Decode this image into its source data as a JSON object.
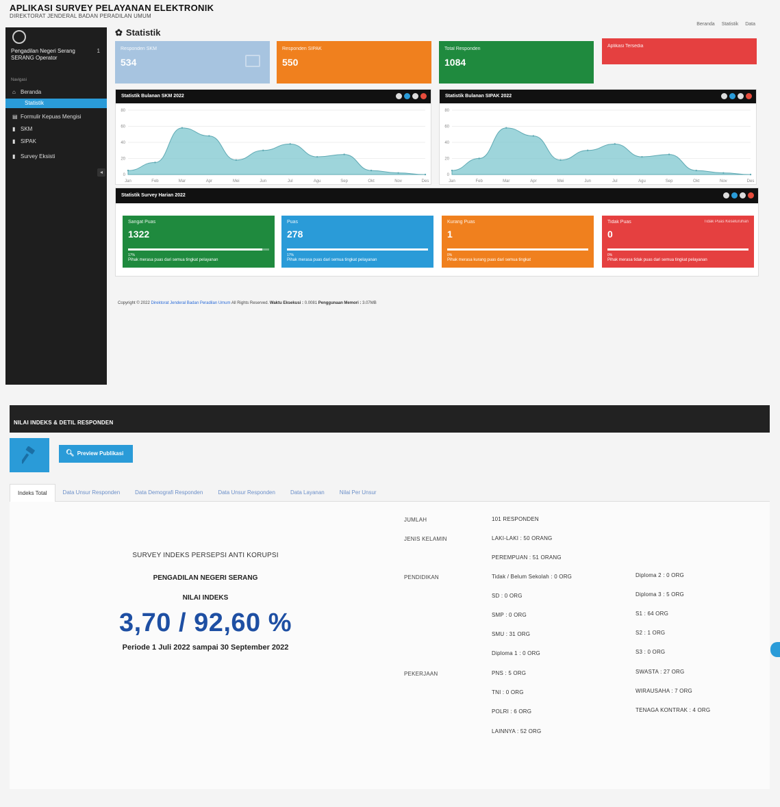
{
  "header": {
    "title": "APLIKASI SURVEY PELAYANAN ELEKTRONIK",
    "subtitle": "DIREKTORAT JENDERAL BADAN PERADILAN UMUM",
    "links": [
      "Beranda",
      "Statistik",
      "Data"
    ]
  },
  "sidebar": {
    "user_name": "Pengadilan Negeri Serang",
    "user_role": "SERANG Operator",
    "badge": "1",
    "section_label": "Navigasi",
    "items": [
      {
        "label": "Beranda",
        "icon": "home-icon",
        "active": false
      },
      {
        "label": "Statistik",
        "icon": "chart-icon",
        "active": true
      },
      {
        "label": "Formulir Kepuas Mengisi",
        "icon": "form-icon",
        "active": false
      },
      {
        "label": "SKM",
        "icon": "file-icon",
        "active": false
      },
      {
        "label": "SIPAK",
        "icon": "file-icon",
        "active": false
      },
      {
        "label": "Survey Eksisti",
        "icon": "file-icon",
        "active": false
      }
    ]
  },
  "stats": {
    "heading": "Statistik",
    "cards": [
      {
        "label": "Responden SKM",
        "value": "534",
        "color": "#a7c4e0"
      },
      {
        "label": "Responden SIPAK",
        "value": "550",
        "color": "#f0801e"
      },
      {
        "label": "Total Responden",
        "value": "1084",
        "color": "#1f8a3e"
      },
      {
        "label": "Aplikasi Tersedia",
        "value": "",
        "color": "#e54040"
      }
    ]
  },
  "chart_data": [
    {
      "type": "area",
      "title": "Statistik Bulanan SKM 2022",
      "x": [
        "Jan",
        "Feb",
        "Mar",
        "Apr",
        "Mei",
        "Jun",
        "Jul",
        "Agu",
        "Sep",
        "Okt",
        "Nov",
        "Des"
      ],
      "values": [
        5,
        15,
        58,
        48,
        18,
        30,
        38,
        22,
        25,
        5,
        2,
        0
      ],
      "ylim": [
        0,
        80
      ],
      "yticks": [
        "0",
        "20",
        "40",
        "60",
        "80"
      ],
      "color": "#7ec7cf"
    },
    {
      "type": "area",
      "title": "Statistik Bulanan SIPAK 2022",
      "x": [
        "Jan",
        "Feb",
        "Mar",
        "Apr",
        "Mei",
        "Jun",
        "Jul",
        "Agu",
        "Sep",
        "Okt",
        "Nov",
        "Des"
      ],
      "values": [
        5,
        20,
        58,
        48,
        18,
        30,
        38,
        22,
        25,
        5,
        2,
        0
      ],
      "ylim": [
        0,
        80
      ],
      "yticks": [
        "0",
        "20",
        "40",
        "60",
        "80"
      ],
      "color": "#7ec7cf"
    }
  ],
  "survey": {
    "title": "Statistik Survey Harian 2022",
    "cards": [
      {
        "label": "Sangat Puas",
        "value": "1322",
        "progress": 0.95,
        "pct": "17%",
        "desc": "Pihak merasa puas dari semua tingkat pelayanan",
        "color": "#1f8a3e"
      },
      {
        "label": "Puas",
        "value": "278",
        "progress": 1.0,
        "pct": "17%",
        "desc": "Pihak merasa puas dari semua tingkat pelayanan",
        "color": "#2a9bd8"
      },
      {
        "label": "Kurang Puas",
        "value": "1",
        "progress": 0.0,
        "pct": "0%",
        "desc": "Pihak merasa kurang puas dari semua tingkat",
        "color": "#f0801e"
      },
      {
        "label": "Tidak Puas",
        "value": "0",
        "progress": 1.0,
        "pct": "0%",
        "desc": "Pihak merasa tidak puas dari semua tingkat pelayanan",
        "color": "#e54040",
        "right_label": "Tidak Puas Keseluruhan"
      }
    ]
  },
  "footer": {
    "copy_prefix": "Copyright © 2022",
    "copy_link": "Direktorat Jenderal Badan Peradilan Umum",
    "copy_rest": "All Rights Reserved.",
    "time_label": "Waktu Eksekusi :",
    "time_value": "0.0081",
    "mem_label": "Penggunaan Memori :",
    "mem_value": "3.07MB"
  },
  "lower": {
    "title": "NILAI INDEKS & DETIL RESPONDEN",
    "preview_label": "Preview Publikasi",
    "tabs": [
      "Indeks Total",
      "Data Unsur Responden",
      "Data Demografi Responden",
      "Data Unsur Responden",
      "Data Layanan",
      "Nilai Per Unsur"
    ],
    "index": {
      "subtitle": "SURVEY INDEKS PERSEPSI ANTI KORUPSI",
      "court": "PENGADILAN NEGERI SERANG",
      "label": "NILAI INDEKS",
      "value": "3,70 / 92,60 %",
      "period": "Periode 1 Juli 2022 sampai 30 September 2022"
    },
    "details": {
      "jumlah_key": "JUMLAH",
      "jumlah_val": "101 RESPONDEN",
      "jk_key": "JENIS KELAMIN",
      "jk_vals": [
        "LAKI-LAKI : 50 ORANG",
        "PEREMPUAN : 51 ORANG"
      ],
      "pend_key": "PENDIDIKAN",
      "pend_col1": [
        "Tidak / Belum Sekolah : 0 ORG",
        "SD : 0 ORG",
        "SMP : 0 ORG",
        "SMU : 31 ORG",
        "Diploma 1 : 0 ORG"
      ],
      "pend_col2": [
        "Diploma 2 : 0 ORG",
        "Diploma 3 : 5 ORG",
        "S1 : 64 ORG",
        "S2 : 1 ORG",
        "S3 : 0 ORG"
      ],
      "pek_key": "PEKERJAAN",
      "pek_col1": [
        "PNS : 5 ORG",
        "TNI : 0 ORG",
        "POLRI : 6 ORG",
        "LAINNYA : 52 ORG"
      ],
      "pek_col2": [
        "SWASTA : 27 ORG",
        "WIRAUSAHA : 7 ORG",
        "TENAGA KONTRAK : 4 ORG"
      ]
    }
  }
}
